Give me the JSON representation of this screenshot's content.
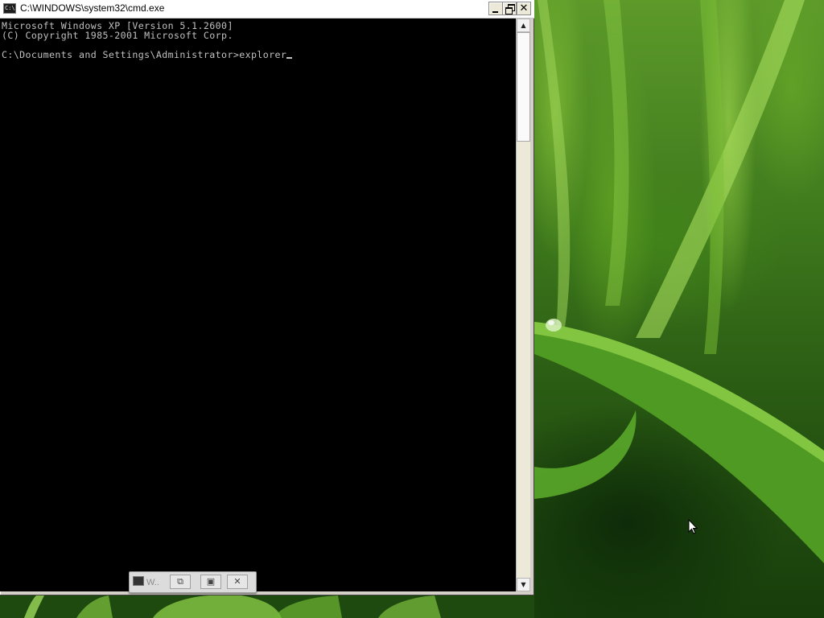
{
  "window": {
    "title": "C:\\WINDOWS\\system32\\cmd.exe",
    "icon": "cmd-icon",
    "icon_text": "C:\\",
    "buttons": {
      "minimize": "minimize-icon",
      "restore": "restore-icon",
      "close": "close-icon"
    }
  },
  "console": {
    "lines": [
      "Microsoft Windows XP [Version 5.1.2600]",
      "(C) Copyright 1985-2001 Microsoft Corp.",
      "",
      "C:\\Documents and Settings\\Administrator>explorer"
    ],
    "text_color": "#c0c0c0",
    "background": "#000000"
  },
  "mini_toolbar": {
    "app_label": "W..",
    "buttons": [
      "restore-icon",
      "maximize-icon",
      "close-icon"
    ],
    "close_glyph": "✕"
  },
  "colors": {
    "titlebar": "#ffffff",
    "wallpaper_green": "#3f7a1d"
  }
}
